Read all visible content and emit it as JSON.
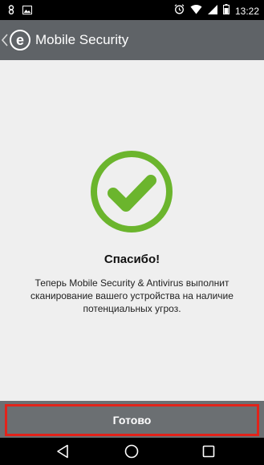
{
  "status_bar": {
    "time": "13:22"
  },
  "app_bar": {
    "logo_letter": "e",
    "title": "Mobile Security"
  },
  "content": {
    "heading": "Спасибо!",
    "message": "Теперь Mobile Security & Antivirus выполнит сканирование вашего устройства на наличие потенциальных угроз."
  },
  "footer": {
    "done_label": "Готово"
  },
  "colors": {
    "app_bar": "#5f6367",
    "content_bg": "#efefef",
    "check_green": "#6bb52d",
    "done_bar": "#6b6f72",
    "highlight_red": "#e2231a"
  },
  "icons": {
    "status_left": [
      "hangouts-icon",
      "image-notification-icon"
    ],
    "status_right": [
      "alarm-icon",
      "wifi-icon",
      "signal-icon",
      "battery-icon"
    ],
    "nav": [
      "back-icon",
      "home-icon",
      "recents-icon"
    ],
    "main": "checkmark-icon"
  }
}
